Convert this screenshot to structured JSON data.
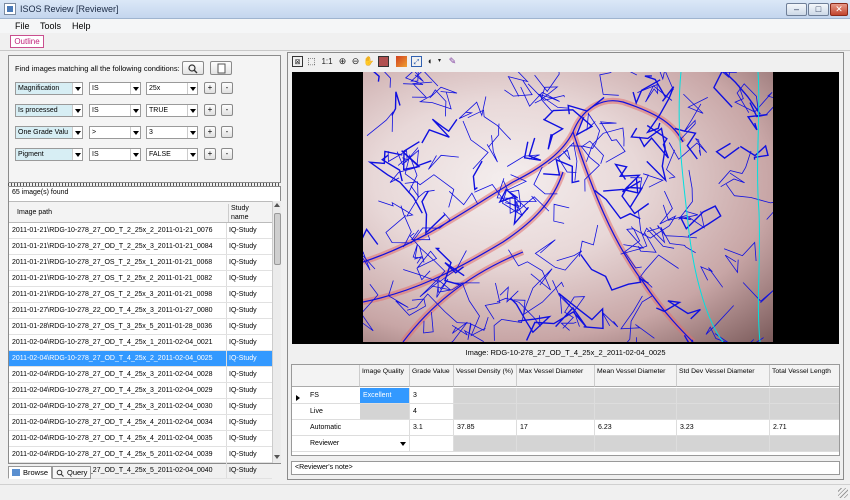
{
  "window": {
    "title": "ISOS Review [Reviewer]",
    "min": "–",
    "max": "□",
    "close": "✕"
  },
  "menu": [
    "File",
    "Tools",
    "Help"
  ],
  "outline_tab": "Outline",
  "query": {
    "label": "Find images matching all the following conditions:",
    "conditions": [
      {
        "field": "Magnification",
        "op": "IS",
        "value": "25x"
      },
      {
        "field": "Is processed",
        "op": "IS",
        "value": "TRUE"
      },
      {
        "field": "One Grade Valu",
        "op": ">",
        "value": "3"
      },
      {
        "field": "Pigment",
        "op": "IS",
        "value": "FALSE"
      }
    ],
    "plus": "+",
    "minus": "-"
  },
  "results": {
    "found": "65 image(s) found",
    "col_path": "Image path",
    "col_study": "Study name",
    "rows": [
      {
        "path": "2011-01-21\\RDG-10-278_27_OD_T_2_25x_2_2011-01-21_0076",
        "study": "IQ-Study"
      },
      {
        "path": "2011-01-21\\RDG-10-278_27_OD_T_2_25x_3_2011-01-21_0084",
        "study": "IQ-Study"
      },
      {
        "path": "2011-01-21\\RDG-10-278_27_OS_T_2_25x_1_2011-01-21_0068",
        "study": "IQ-Study"
      },
      {
        "path": "2011-01-21\\RDG-10-278_27_OS_T_2_25x_2_2011-01-21_0082",
        "study": "IQ-Study"
      },
      {
        "path": "2011-01-21\\RDG-10-278_27_OS_T_2_25x_3_2011-01-21_0098",
        "study": "IQ-Study"
      },
      {
        "path": "2011-01-27\\RDG-10-278_22_OD_T_4_25x_3_2011-01-27_0080",
        "study": "IQ-Study"
      },
      {
        "path": "2011-01-28\\RDG-10-278_27_OS_T_3_25x_5_2011-01-28_0036",
        "study": "IQ-Study"
      },
      {
        "path": "2011-02-04\\RDG-10-278_27_OD_T_4_25x_1_2011-02-04_0021",
        "study": "IQ-Study"
      },
      {
        "path": "2011-02-04\\RDG-10-278_27_OD_T_4_25x_2_2011-02-04_0025",
        "study": "IQ-Study",
        "selected": true
      },
      {
        "path": "2011-02-04\\RDG-10-278_27_OD_T_4_25x_3_2011-02-04_0028",
        "study": "IQ-Study"
      },
      {
        "path": "2011-02-04\\RDG-10-278_27_OD_T_4_25x_3_2011-02-04_0029",
        "study": "IQ-Study"
      },
      {
        "path": "2011-02-04\\RDG-10-278_27_OD_T_4_25x_3_2011-02-04_0030",
        "study": "IQ-Study"
      },
      {
        "path": "2011-02-04\\RDG-10-278_27_OD_T_4_25x_4_2011-02-04_0034",
        "study": "IQ-Study"
      },
      {
        "path": "2011-02-04\\RDG-10-278_27_OD_T_4_25x_4_2011-02-04_0035",
        "study": "IQ-Study"
      },
      {
        "path": "2011-02-04\\RDG-10-278_27_OD_T_4_25x_5_2011-02-04_0039",
        "study": "IQ-Study"
      },
      {
        "path": "2011-02-04\\RDG-10-278_27_OD_T_4_25x_5_2011-02-04_0040",
        "study": "IQ-Study"
      }
    ]
  },
  "bottom_tabs": [
    "Browse",
    "Query"
  ],
  "toolbar": {
    "one_to_one": "1:1"
  },
  "image_caption": "Image: RDG-10-278_27_OD_T_4_25x_2_2011-02-04_0025",
  "review": {
    "headers": [
      "Image Quality",
      "Grade Value",
      "Vessel Density (%)",
      "Max Vessel Diameter",
      "Mean Vessel Diameter",
      "Std Dev Vessel Diameter",
      "Total Vessel Length"
    ],
    "rows": [
      {
        "label": "FS",
        "cells": [
          "Excellent",
          "3",
          "",
          "",
          "",
          "",
          ""
        ]
      },
      {
        "label": "Live",
        "cells": [
          "",
          "4",
          "",
          "",
          "",
          "",
          ""
        ]
      },
      {
        "label": "Automatic",
        "cells": [
          "",
          "3.1",
          "37.85",
          "17",
          "6.23",
          "3.23",
          "2.71"
        ]
      },
      {
        "label": "Reviewer",
        "cells": [
          "",
          "",
          "",
          "",
          "",
          "",
          ""
        ]
      }
    ],
    "note_placeholder": "<Reviewer's note>"
  },
  "colors": {
    "selection": "#3399ff",
    "vessel": "#1010e0",
    "boundary": "#00e0e0",
    "accent": "#c0207a"
  }
}
